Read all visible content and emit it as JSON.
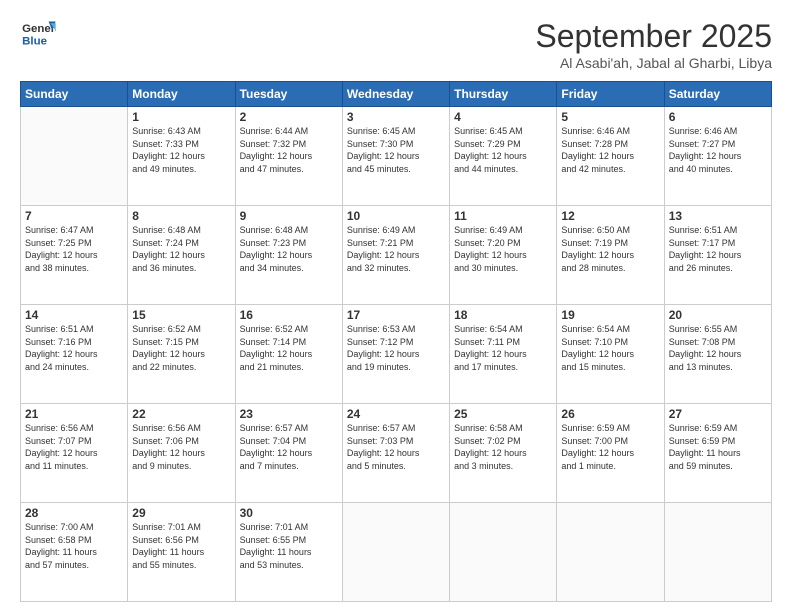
{
  "header": {
    "logo_general": "General",
    "logo_blue": "Blue",
    "month_title": "September 2025",
    "subtitle": "Al Asabi'ah, Jabal al Gharbi, Libya"
  },
  "days_of_week": [
    "Sunday",
    "Monday",
    "Tuesday",
    "Wednesday",
    "Thursday",
    "Friday",
    "Saturday"
  ],
  "weeks": [
    [
      {
        "num": "",
        "lines": []
      },
      {
        "num": "1",
        "lines": [
          "Sunrise: 6:43 AM",
          "Sunset: 7:33 PM",
          "Daylight: 12 hours",
          "and 49 minutes."
        ]
      },
      {
        "num": "2",
        "lines": [
          "Sunrise: 6:44 AM",
          "Sunset: 7:32 PM",
          "Daylight: 12 hours",
          "and 47 minutes."
        ]
      },
      {
        "num": "3",
        "lines": [
          "Sunrise: 6:45 AM",
          "Sunset: 7:30 PM",
          "Daylight: 12 hours",
          "and 45 minutes."
        ]
      },
      {
        "num": "4",
        "lines": [
          "Sunrise: 6:45 AM",
          "Sunset: 7:29 PM",
          "Daylight: 12 hours",
          "and 44 minutes."
        ]
      },
      {
        "num": "5",
        "lines": [
          "Sunrise: 6:46 AM",
          "Sunset: 7:28 PM",
          "Daylight: 12 hours",
          "and 42 minutes."
        ]
      },
      {
        "num": "6",
        "lines": [
          "Sunrise: 6:46 AM",
          "Sunset: 7:27 PM",
          "Daylight: 12 hours",
          "and 40 minutes."
        ]
      }
    ],
    [
      {
        "num": "7",
        "lines": [
          "Sunrise: 6:47 AM",
          "Sunset: 7:25 PM",
          "Daylight: 12 hours",
          "and 38 minutes."
        ]
      },
      {
        "num": "8",
        "lines": [
          "Sunrise: 6:48 AM",
          "Sunset: 7:24 PM",
          "Daylight: 12 hours",
          "and 36 minutes."
        ]
      },
      {
        "num": "9",
        "lines": [
          "Sunrise: 6:48 AM",
          "Sunset: 7:23 PM",
          "Daylight: 12 hours",
          "and 34 minutes."
        ]
      },
      {
        "num": "10",
        "lines": [
          "Sunrise: 6:49 AM",
          "Sunset: 7:21 PM",
          "Daylight: 12 hours",
          "and 32 minutes."
        ]
      },
      {
        "num": "11",
        "lines": [
          "Sunrise: 6:49 AM",
          "Sunset: 7:20 PM",
          "Daylight: 12 hours",
          "and 30 minutes."
        ]
      },
      {
        "num": "12",
        "lines": [
          "Sunrise: 6:50 AM",
          "Sunset: 7:19 PM",
          "Daylight: 12 hours",
          "and 28 minutes."
        ]
      },
      {
        "num": "13",
        "lines": [
          "Sunrise: 6:51 AM",
          "Sunset: 7:17 PM",
          "Daylight: 12 hours",
          "and 26 minutes."
        ]
      }
    ],
    [
      {
        "num": "14",
        "lines": [
          "Sunrise: 6:51 AM",
          "Sunset: 7:16 PM",
          "Daylight: 12 hours",
          "and 24 minutes."
        ]
      },
      {
        "num": "15",
        "lines": [
          "Sunrise: 6:52 AM",
          "Sunset: 7:15 PM",
          "Daylight: 12 hours",
          "and 22 minutes."
        ]
      },
      {
        "num": "16",
        "lines": [
          "Sunrise: 6:52 AM",
          "Sunset: 7:14 PM",
          "Daylight: 12 hours",
          "and 21 minutes."
        ]
      },
      {
        "num": "17",
        "lines": [
          "Sunrise: 6:53 AM",
          "Sunset: 7:12 PM",
          "Daylight: 12 hours",
          "and 19 minutes."
        ]
      },
      {
        "num": "18",
        "lines": [
          "Sunrise: 6:54 AM",
          "Sunset: 7:11 PM",
          "Daylight: 12 hours",
          "and 17 minutes."
        ]
      },
      {
        "num": "19",
        "lines": [
          "Sunrise: 6:54 AM",
          "Sunset: 7:10 PM",
          "Daylight: 12 hours",
          "and 15 minutes."
        ]
      },
      {
        "num": "20",
        "lines": [
          "Sunrise: 6:55 AM",
          "Sunset: 7:08 PM",
          "Daylight: 12 hours",
          "and 13 minutes."
        ]
      }
    ],
    [
      {
        "num": "21",
        "lines": [
          "Sunrise: 6:56 AM",
          "Sunset: 7:07 PM",
          "Daylight: 12 hours",
          "and 11 minutes."
        ]
      },
      {
        "num": "22",
        "lines": [
          "Sunrise: 6:56 AM",
          "Sunset: 7:06 PM",
          "Daylight: 12 hours",
          "and 9 minutes."
        ]
      },
      {
        "num": "23",
        "lines": [
          "Sunrise: 6:57 AM",
          "Sunset: 7:04 PM",
          "Daylight: 12 hours",
          "and 7 minutes."
        ]
      },
      {
        "num": "24",
        "lines": [
          "Sunrise: 6:57 AM",
          "Sunset: 7:03 PM",
          "Daylight: 12 hours",
          "and 5 minutes."
        ]
      },
      {
        "num": "25",
        "lines": [
          "Sunrise: 6:58 AM",
          "Sunset: 7:02 PM",
          "Daylight: 12 hours",
          "and 3 minutes."
        ]
      },
      {
        "num": "26",
        "lines": [
          "Sunrise: 6:59 AM",
          "Sunset: 7:00 PM",
          "Daylight: 12 hours",
          "and 1 minute."
        ]
      },
      {
        "num": "27",
        "lines": [
          "Sunrise: 6:59 AM",
          "Sunset: 6:59 PM",
          "Daylight: 11 hours",
          "and 59 minutes."
        ]
      }
    ],
    [
      {
        "num": "28",
        "lines": [
          "Sunrise: 7:00 AM",
          "Sunset: 6:58 PM",
          "Daylight: 11 hours",
          "and 57 minutes."
        ]
      },
      {
        "num": "29",
        "lines": [
          "Sunrise: 7:01 AM",
          "Sunset: 6:56 PM",
          "Daylight: 11 hours",
          "and 55 minutes."
        ]
      },
      {
        "num": "30",
        "lines": [
          "Sunrise: 7:01 AM",
          "Sunset: 6:55 PM",
          "Daylight: 11 hours",
          "and 53 minutes."
        ]
      },
      {
        "num": "",
        "lines": []
      },
      {
        "num": "",
        "lines": []
      },
      {
        "num": "",
        "lines": []
      },
      {
        "num": "",
        "lines": []
      }
    ]
  ]
}
